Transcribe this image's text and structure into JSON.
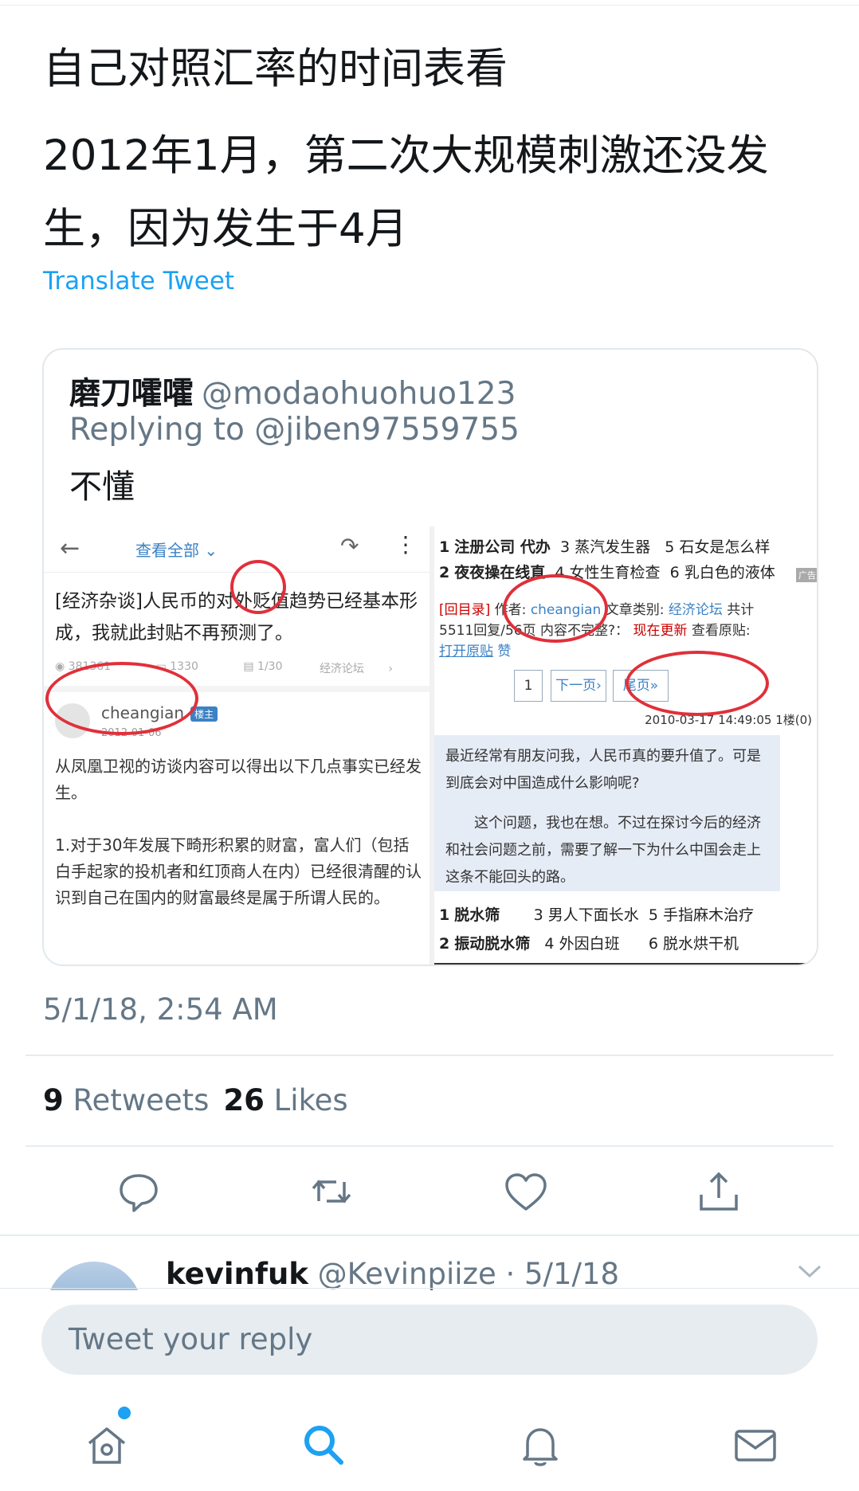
{
  "tweet": {
    "line1": "自己对照汇率的时间表看",
    "line2": "2012年1月，第二次大规模刺激还没发生，因为发生于4月",
    "translate_label": "Translate Tweet",
    "timestamp": "5/1/18, 2:54 AM",
    "retweets_count": "9",
    "retweets_label": "Retweets",
    "likes_count": "26",
    "likes_label": "Likes"
  },
  "quote": {
    "name": "磨刀嚯嚯",
    "handle": "@modaohuohuo123",
    "replying_prefix": "Replying to",
    "replying_handle": "@jiben97559755",
    "text": "不懂",
    "left_image": {
      "view_all": "查看全部",
      "title": "[经济杂谈]人民币的对外贬值趋势已经基本形成，我就此封贴不再预测了。",
      "views": "381361",
      "replies": "1330",
      "pages": "1/30",
      "forum": "经济论坛",
      "user": "cheangian",
      "badge": "楼主",
      "date": "2012-01-06",
      "post": "从凤凰卫视的访谈内容可以得出以下几点事实已经发生。\n\n1.对于30年发展下畸形积累的财富，富人们（包括白手起家的投机者和红顶商人在内）已经很清醒的认识到自己在国内的财富最终是属于所谓人民的。"
    },
    "right_image": {
      "ad_row1": {
        "n1": "1",
        "t1": "注册公司 代办",
        "n2": "3",
        "t2": "蒸汽发生器",
        "n3": "5",
        "t3": "石女是怎么样"
      },
      "ad_row2": {
        "n1": "2",
        "t1": "夜夜操在线直",
        "n2": "4",
        "t2": "女性生育检查",
        "n3": "6",
        "t3": "乳白色的液体"
      },
      "ad_tag": "广告",
      "back_link": "[回目录]",
      "author_label": "作者:",
      "author": "cheangian",
      "category_label": "文章类别:",
      "category": "经济论坛",
      "total_label": "共计",
      "stats": "5511回复/56页 内容不完整?：",
      "refresh": "现在更新",
      "view_original": "查看原贴:",
      "open_original": "打开原贴",
      "like": "赞",
      "page_current": "1",
      "next_page": "下一页›",
      "last_page": "尾页»",
      "floor": "2010-03-17 14:49:05 1楼(0)",
      "post_line1": "最近经常有朋友问我，人民币真的要升值了。可是到底会对中国造成什么影响呢?",
      "post_line2": "这个问题，我也在想。不过在探讨今后的经济和社会问题之前，需要了解一下为什么中国会走上这条不能回头的路。",
      "ad2_row1": {
        "n1": "1",
        "t1": "脱水筛",
        "n2": "3",
        "t2": "男人下面长水",
        "n3": "5",
        "t3": "手指麻木治疗"
      },
      "ad2_row2": {
        "n1": "2",
        "t1": "振动脱水筛",
        "n2": "4",
        "t2": "外因白班",
        "n3": "6",
        "t3": "脱水烘干机"
      }
    }
  },
  "reply_preview": {
    "name": "kevinfuk",
    "handle_date": "@Kevinpiize · 5/1/18"
  },
  "compose": {
    "placeholder": "Tweet your reply"
  },
  "icons": [
    "reply-icon",
    "retweet-icon",
    "like-icon",
    "share-icon",
    "home-icon",
    "search-icon",
    "notifications-icon",
    "messages-icon",
    "chevron-down-icon"
  ],
  "colors": {
    "accent": "#1da1f2",
    "secondary_text": "#657786",
    "annotation_red": "#e0303a"
  }
}
